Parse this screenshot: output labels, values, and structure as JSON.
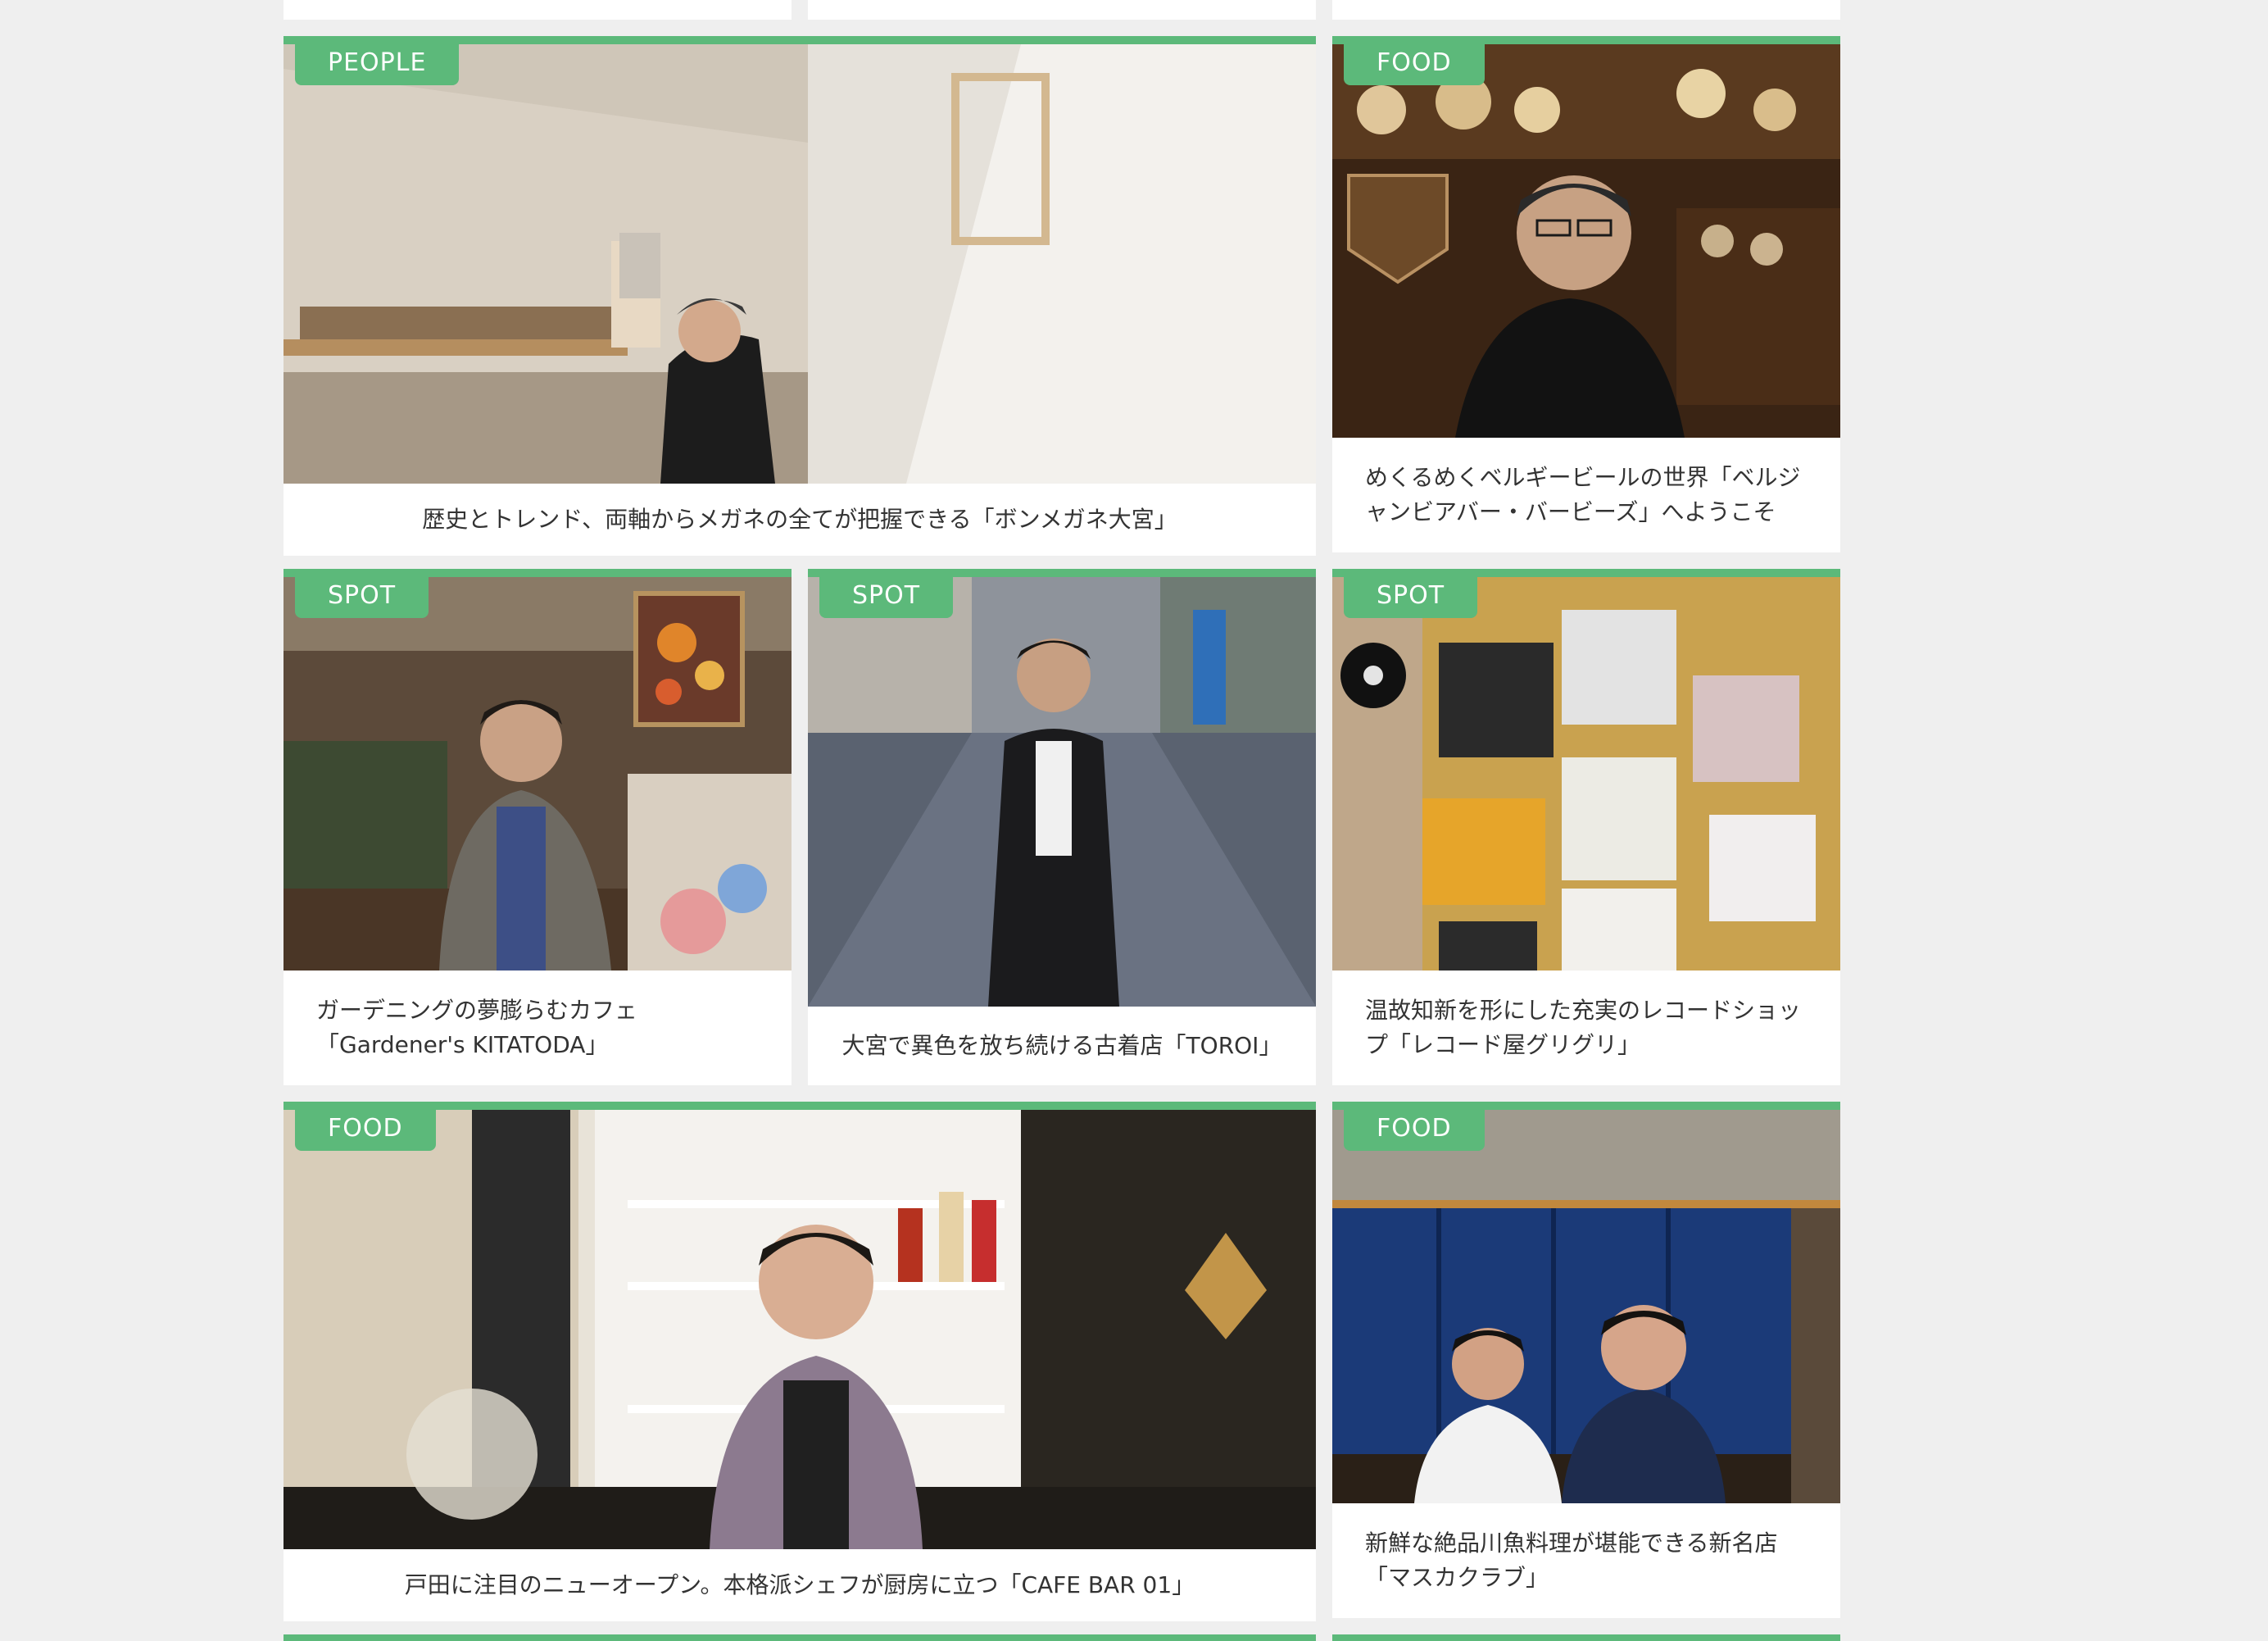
{
  "colors": {
    "page_background": "#efefef",
    "card_background": "#ffffff",
    "accent_green": "#5cb97a",
    "caption_text": "#333333"
  },
  "articles": [
    {
      "category": "PEOPLE",
      "title": "歴史とトレンド、両軸からメガネの全てが把握できる「ボンメガネ大宮」",
      "image": "eyewear-shop-photo"
    },
    {
      "category": "FOOD",
      "title_lines": [
        "めくるめくベルギービールの世界「ベルジ",
        "ャンビアバー・バービーズ」へようこそ"
      ],
      "image": "belgian-beer-bar-photo"
    },
    {
      "category": "SPOT",
      "title_lines": [
        "ガーデニングの夢膨らむカフェ",
        "「Gardener's KITATODA」"
      ],
      "image": "garden-cafe-photo"
    },
    {
      "category": "SPOT",
      "title": "大宮で異色を放ち続ける古着店「TOROI」",
      "image": "street-portrait-photo"
    },
    {
      "category": "SPOT",
      "title_lines": [
        "温故知新を形にした充実のレコードショッ",
        "プ「レコード屋グリグリ」"
      ],
      "image": "record-shop-photo"
    },
    {
      "category": "FOOD",
      "title": "戸田に注目のニューオープン。本格派シェフが厨房に立つ「CAFE BAR 01」",
      "image": "cafe-bar-photo"
    },
    {
      "category": "FOOD",
      "title_lines": [
        "新鮮な絶品川魚料理が堪能できる新名店",
        "「マスカクラブ」"
      ],
      "image": "restaurant-entrance-photo"
    }
  ]
}
